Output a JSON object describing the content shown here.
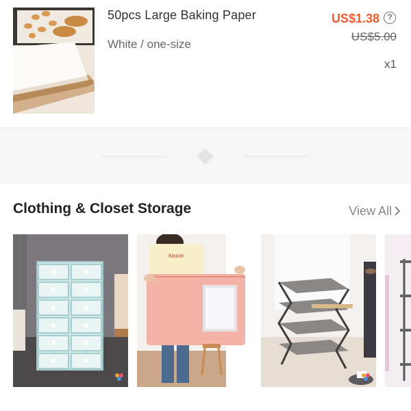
{
  "order_item": {
    "title": "50pcs Large Baking Paper",
    "variant": "White / one-size",
    "price": "US$1.38",
    "original_price": "US$5.00",
    "quantity": "x1",
    "help_icon": "question-circle-icon",
    "help_glyph": "?",
    "image": "baking-paper-product-image"
  },
  "section": {
    "title": "Clothing & Closet Storage",
    "view_all_label": "View All",
    "chevron_icon": "chevron-right-icon",
    "products": [
      {
        "image": "clear-shoe-box-stack-image"
      },
      {
        "image": "pink-storage-bag-image",
        "shirt_text": "Annie"
      },
      {
        "image": "foldable-shoe-rack-image"
      },
      {
        "image": "metal-shelf-rack-image"
      }
    ]
  },
  "colors": {
    "price": "#f25a2c",
    "muted_text": "#888888",
    "divider_bg": "#f6f6f6"
  }
}
